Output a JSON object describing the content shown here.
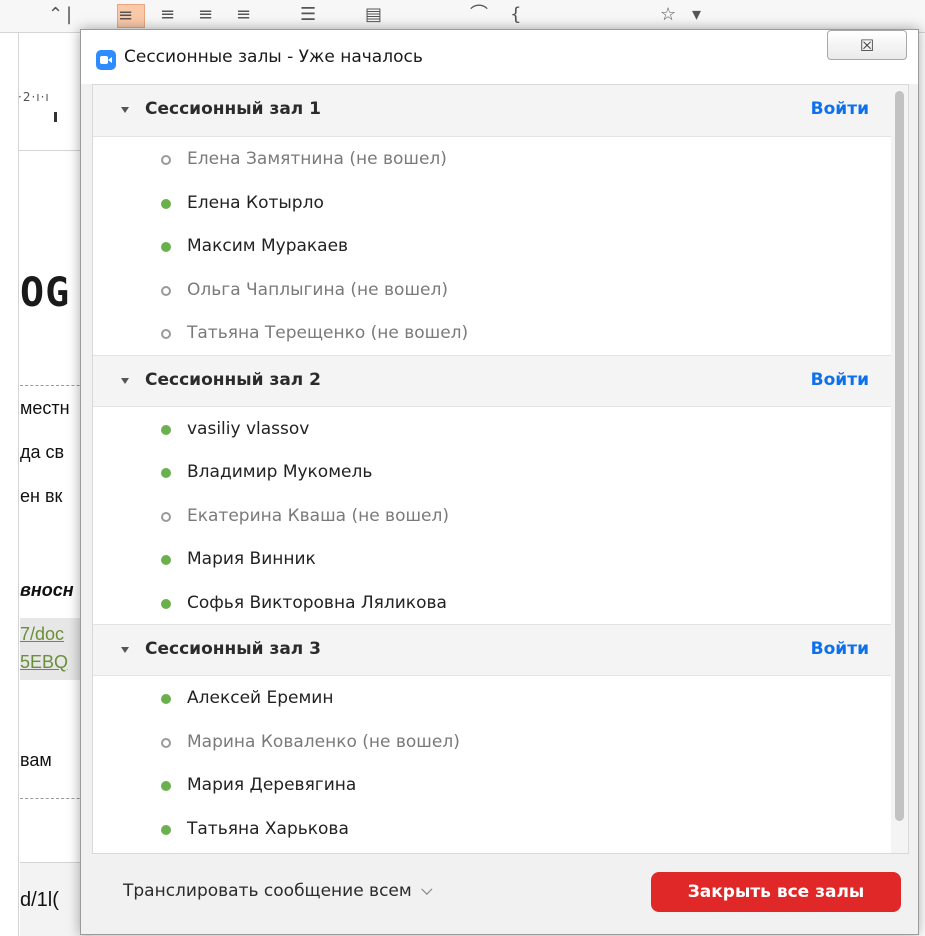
{
  "background": {
    "ruler_text": "·2·ı·ı",
    "heading_fragment": "OG",
    "lines": [
      "местн",
      "да св",
      "ен вк"
    ],
    "italic_fragment": "вносн",
    "link_lines": [
      "7/doc",
      "5EBQ"
    ],
    "line_vam": "вам",
    "status_fragment": "d/1l("
  },
  "dialog": {
    "title": "Сессионные залы - Уже началось",
    "close_glyph": "☒"
  },
  "rooms": [
    {
      "title": "Сессионный зал 1",
      "join_label": "Войти",
      "participants": [
        {
          "name": "Елена Замятнина (не вошел)",
          "status": "offline"
        },
        {
          "name": "Елена Котырло",
          "status": "online"
        },
        {
          "name": "Максим Муракаев",
          "status": "online"
        },
        {
          "name": "Ольга Чаплыгина (не вошел)",
          "status": "offline"
        },
        {
          "name": "Татьяна Терещенко (не вошел)",
          "status": "offline"
        }
      ]
    },
    {
      "title": "Сессионный зал 2",
      "join_label": "Войти",
      "participants": [
        {
          "name": "vasiliy vlassov",
          "status": "online"
        },
        {
          "name": "Владимир Мукомель",
          "status": "online"
        },
        {
          "name": "Екатерина Кваша (не вошел)",
          "status": "offline"
        },
        {
          "name": "Мария Винник",
          "status": "online"
        },
        {
          "name": "Софья Викторовна Ляликова",
          "status": "online"
        }
      ]
    },
    {
      "title": "Сессионный зал 3",
      "join_label": "Войти",
      "participants": [
        {
          "name": "Алексей Еремин",
          "status": "online"
        },
        {
          "name": "Марина Коваленко (не вошел)",
          "status": "offline"
        },
        {
          "name": "Мария Деревягина",
          "status": "online"
        },
        {
          "name": "Татьяна Харькова",
          "status": "online"
        }
      ]
    }
  ],
  "footer": {
    "broadcast_label": "Транслировать сообщение всем",
    "close_all_label": "Закрыть все залы"
  },
  "colors": {
    "join_link": "#0e71eb",
    "online_dot": "#6ab04c",
    "close_all_button": "#e02828",
    "app_icon": "#2d8cff"
  }
}
